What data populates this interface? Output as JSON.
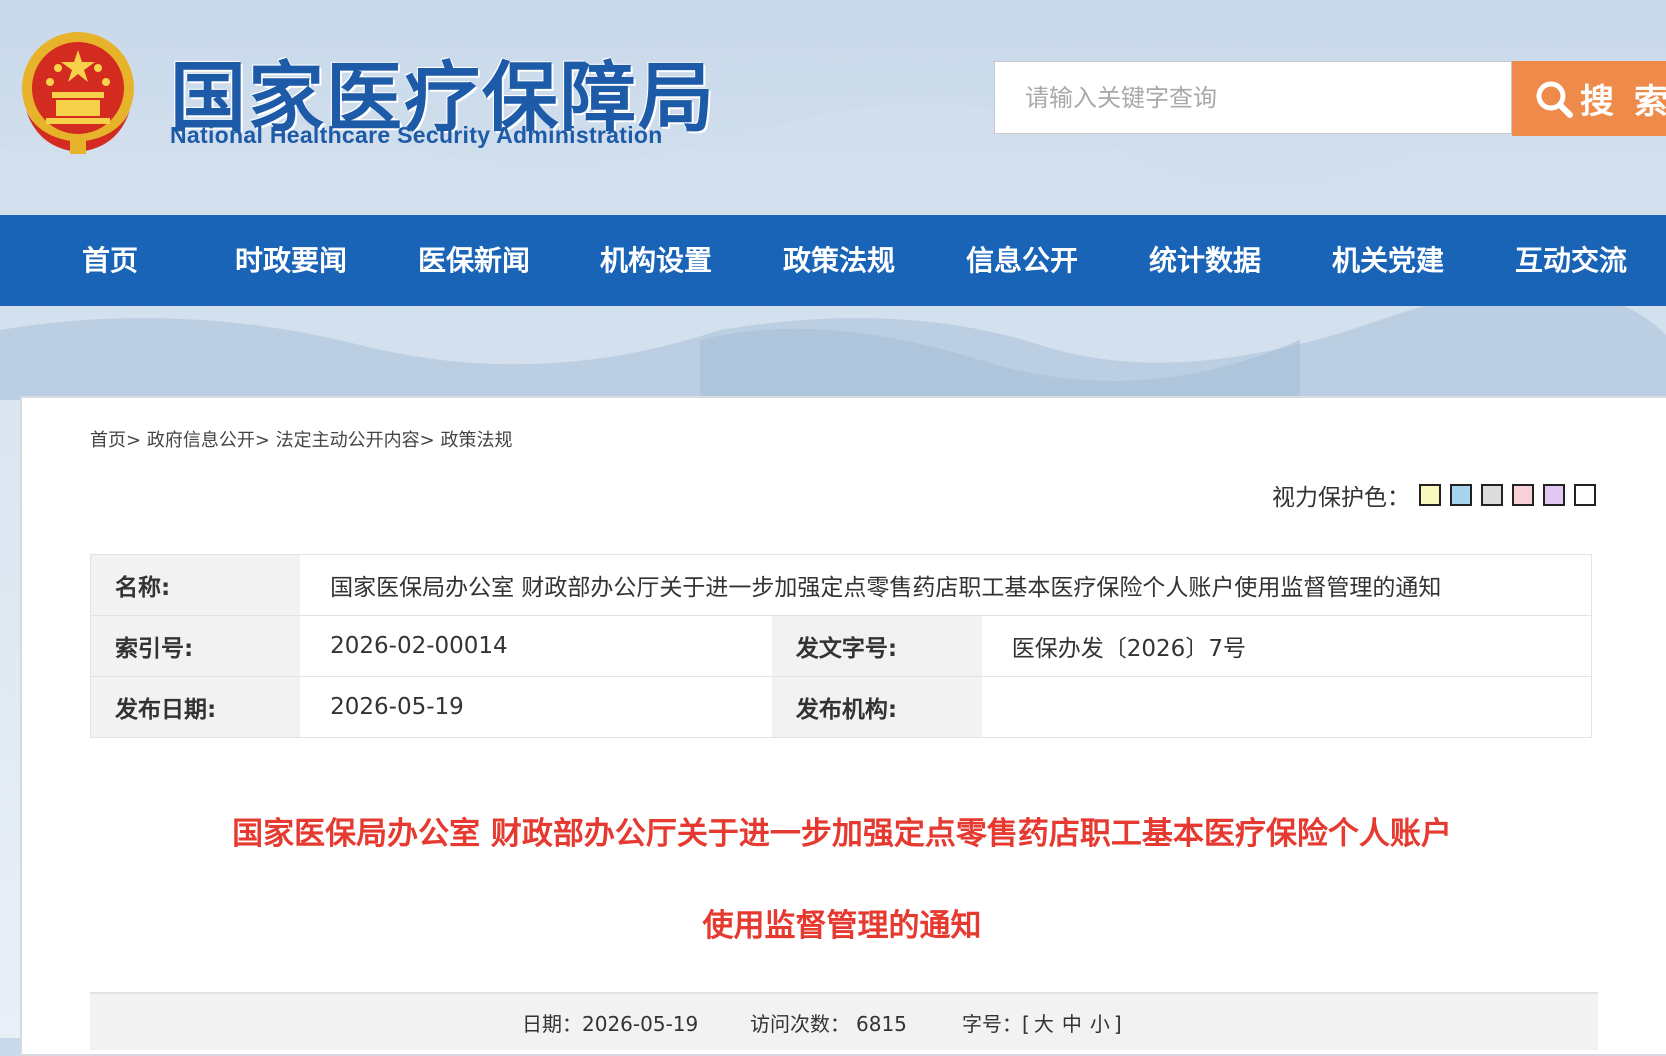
{
  "header": {
    "logo_cn": "国家医疗保障局",
    "logo_en": "National Healthcare Security Administration",
    "search": {
      "placeholder": "请输入关键字查询",
      "button_label": "搜 索"
    }
  },
  "nav": {
    "items": [
      "首页",
      "时政要闻",
      "医保新闻",
      "机构设置",
      "政策法规",
      "信息公开",
      "统计数据",
      "机关党建",
      "互动交流"
    ]
  },
  "breadcrumb": [
    "首页>",
    "政府信息公开>",
    "法定主动公开内容>",
    "政策法规"
  ],
  "eye_protect": {
    "label": "视力保护色：",
    "colors": [
      "#fafabe",
      "#a8d4ef",
      "#dcdcdc",
      "#f7d0d8",
      "#e0c8f2",
      "#ffffff"
    ]
  },
  "info": {
    "name_label": "名称:",
    "name_value": "国家医保局办公室 财政部办公厅关于进一步加强定点零售药店职工基本医疗保险个人账户使用监督管理的通知",
    "index_label": "索引号:",
    "index_value": "2026-02-00014",
    "doc_no_label": "发文字号:",
    "doc_no_value": "医保办发〔2026〕7号",
    "date_label": "发布日期:",
    "date_value": "2026-05-19",
    "org_label": "发布机构:",
    "org_value": ""
  },
  "article": {
    "title_line1": "国家医保局办公室 财政部办公厅关于进一步加强定点零售药店职工基本医疗保险个人账户",
    "title_line2": "使用监督管理的通知"
  },
  "meta": {
    "date_label": "日期：",
    "date_value": "2026-05-19",
    "visits_label": "访问次数：",
    "visits_value": "6815",
    "fontsize_label": "字号：[",
    "size_large": "大",
    "size_medium": "中",
    "size_small": "小",
    "fontsize_end": "]"
  },
  "colors": {
    "nav_bg": "#1a64b8",
    "brand_blue": "#1d5aa8",
    "search_button": "#ee8a4a",
    "title_red": "#e63a31"
  }
}
